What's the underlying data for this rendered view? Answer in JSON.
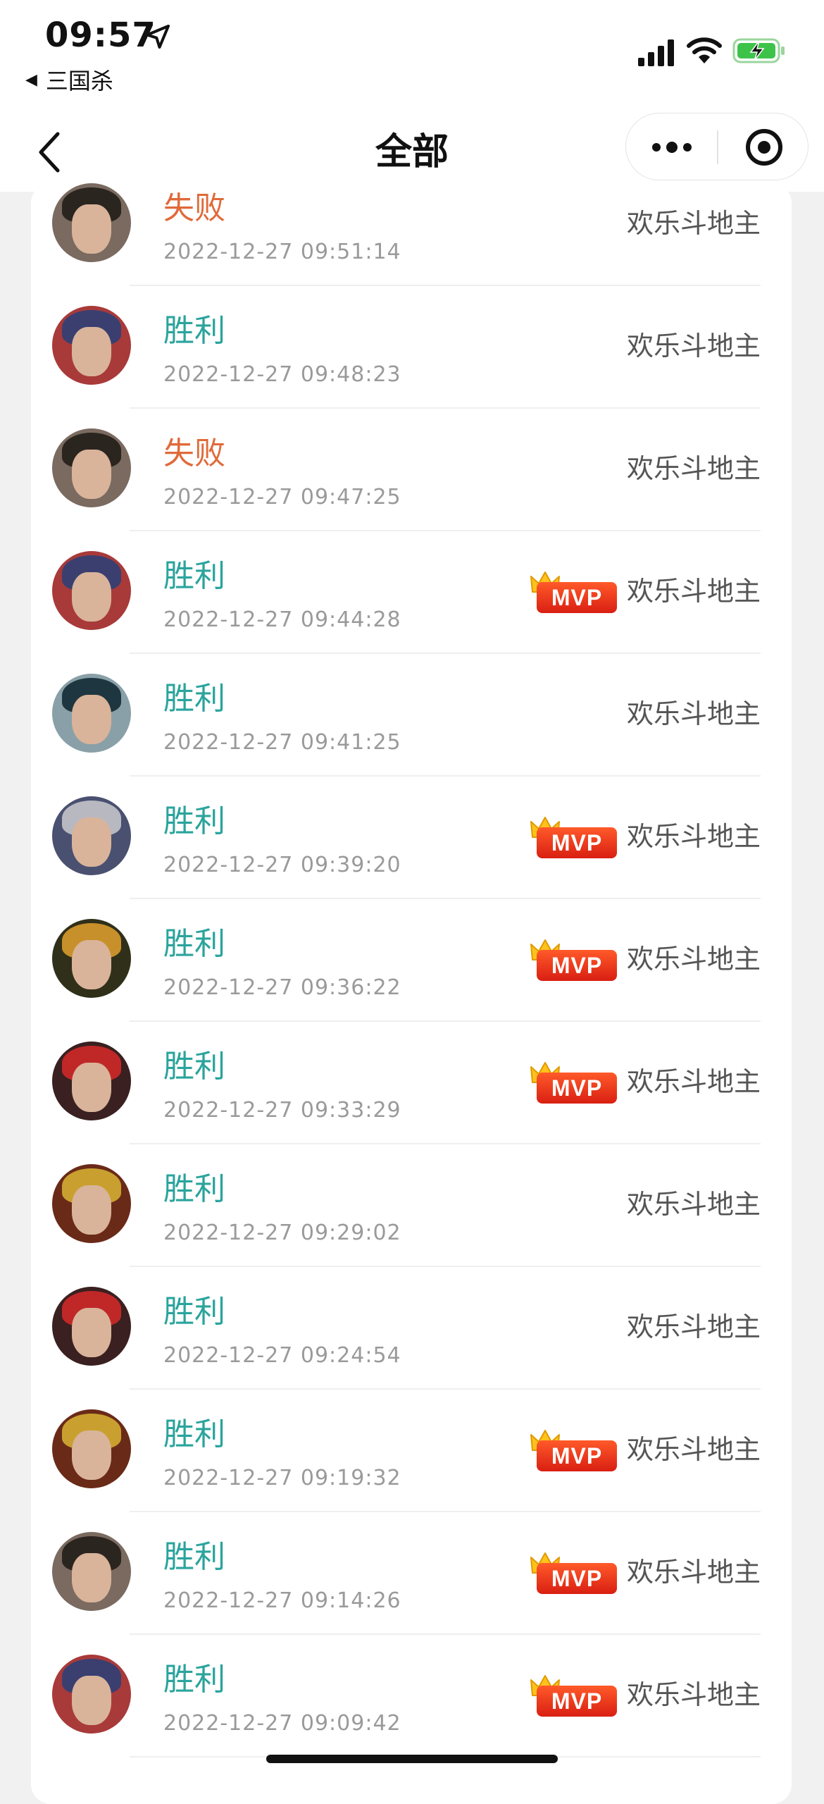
{
  "status_bar": {
    "time": "09:57",
    "back_app": "三国杀",
    "icons": [
      "location-arrow-icon",
      "signal-icon",
      "wifi-icon",
      "battery-charging-icon"
    ]
  },
  "nav": {
    "title": "全部",
    "back_icon": "chevron-left-icon",
    "more_icon": "more-dots-icon",
    "close_icon": "target-close-icon"
  },
  "colors": {
    "win": "#2aa49c",
    "lose": "#e06a3a",
    "mvp": "#e8331c"
  },
  "mvp_label": "MVP",
  "records": [
    {
      "result": "失败",
      "outcome": "lose",
      "time": "2022-12-27 09:51:14",
      "mvp": false,
      "mode": "欢乐斗地主",
      "hair": "#2b2520",
      "bg": "#7a6a60"
    },
    {
      "result": "胜利",
      "outcome": "win",
      "time": "2022-12-27 09:48:23",
      "mvp": false,
      "mode": "欢乐斗地主",
      "hair": "#3a3f70",
      "bg": "#a83a3a"
    },
    {
      "result": "失败",
      "outcome": "lose",
      "time": "2022-12-27 09:47:25",
      "mvp": false,
      "mode": "欢乐斗地主",
      "hair": "#2b2520",
      "bg": "#7a6a60"
    },
    {
      "result": "胜利",
      "outcome": "win",
      "time": "2022-12-27 09:44:28",
      "mvp": true,
      "mode": "欢乐斗地主",
      "hair": "#3a3f70",
      "bg": "#a83a3a"
    },
    {
      "result": "胜利",
      "outcome": "win",
      "time": "2022-12-27 09:41:25",
      "mvp": false,
      "mode": "欢乐斗地主",
      "hair": "#1e3640",
      "bg": "#8aa0a8"
    },
    {
      "result": "胜利",
      "outcome": "win",
      "time": "2022-12-27 09:39:20",
      "mvp": true,
      "mode": "欢乐斗地主",
      "hair": "#b8b8c0",
      "bg": "#4a5070"
    },
    {
      "result": "胜利",
      "outcome": "win",
      "time": "2022-12-27 09:36:22",
      "mvp": true,
      "mode": "欢乐斗地主",
      "hair": "#c8902a",
      "bg": "#30301a"
    },
    {
      "result": "胜利",
      "outcome": "win",
      "time": "2022-12-27 09:33:29",
      "mvp": true,
      "mode": "欢乐斗地主",
      "hair": "#c02828",
      "bg": "#3a2020"
    },
    {
      "result": "胜利",
      "outcome": "win",
      "time": "2022-12-27 09:29:02",
      "mvp": false,
      "mode": "欢乐斗地主",
      "hair": "#c9a030",
      "bg": "#6a2a18"
    },
    {
      "result": "胜利",
      "outcome": "win",
      "time": "2022-12-27 09:24:54",
      "mvp": false,
      "mode": "欢乐斗地主",
      "hair": "#c02828",
      "bg": "#3a2020"
    },
    {
      "result": "胜利",
      "outcome": "win",
      "time": "2022-12-27 09:19:32",
      "mvp": true,
      "mode": "欢乐斗地主",
      "hair": "#c9a030",
      "bg": "#6a2a18"
    },
    {
      "result": "胜利",
      "outcome": "win",
      "time": "2022-12-27 09:14:26",
      "mvp": true,
      "mode": "欢乐斗地主",
      "hair": "#2b2520",
      "bg": "#7a6a60"
    },
    {
      "result": "胜利",
      "outcome": "win",
      "time": "2022-12-27 09:09:42",
      "mvp": true,
      "mode": "欢乐斗地主",
      "hair": "#3a3f70",
      "bg": "#a83a3a"
    }
  ]
}
